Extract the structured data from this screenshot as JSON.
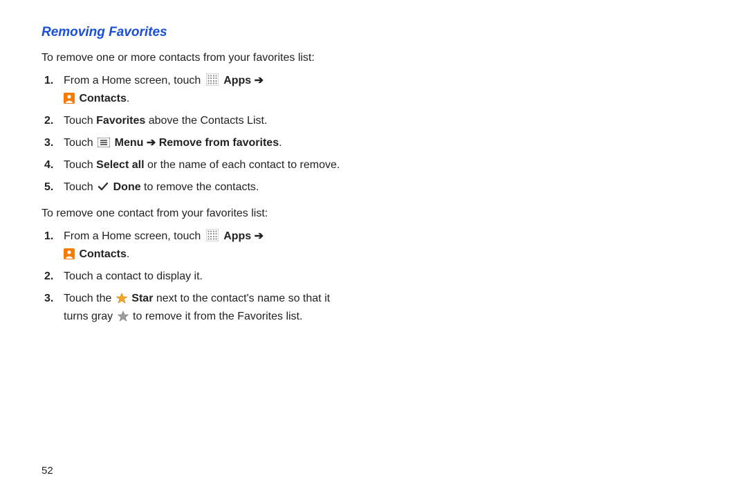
{
  "heading": "Removing Favorites",
  "intro1": "To remove one or more contacts from your favorites list:",
  "intro2": "To remove one contact from your favorites list:",
  "arrow": "➔",
  "listA": {
    "s1": {
      "t1": "From a Home screen, touch",
      "apps": "Apps",
      "contacts": "Contacts",
      "t2": "."
    },
    "s2": {
      "t1": "Touch ",
      "bold": "Favorites",
      "t2": " above the Contacts List."
    },
    "s3": {
      "t1": "Touch",
      "menu": "Menu",
      "remove": "Remove from favorites",
      "t2": "."
    },
    "s4": {
      "t1": "Touch ",
      "bold": "Select all",
      "t2": " or the name of each contact to remove."
    },
    "s5": {
      "t1": "Touch",
      "done": "Done",
      "t2": " to remove the contacts."
    }
  },
  "listB": {
    "s1": {
      "t1": "From a Home screen, touch",
      "apps": "Apps",
      "contacts": "Contacts",
      "t2": "."
    },
    "s2": {
      "t1": "Touch a contact to display it."
    },
    "s3": {
      "t1": "Touch the",
      "star": "Star",
      "t2": " next to the contact's name so that it",
      "t3": "turns gray",
      "t4": " to remove it from the Favorites list."
    }
  },
  "pageNumber": "52"
}
